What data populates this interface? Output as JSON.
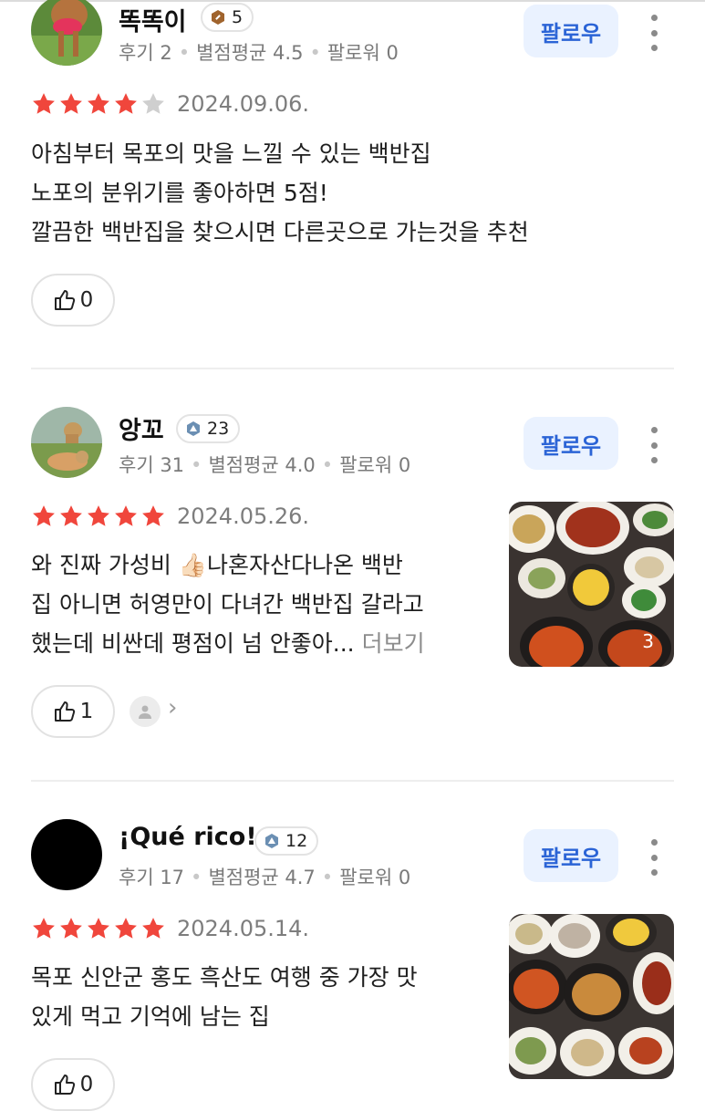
{
  "follow_label": "팔로우",
  "reviews": [
    {
      "username": "똑똑이",
      "badge_level": "5",
      "stats": {
        "reviews": "후기 2",
        "avg_rating": "별점평균 4.5",
        "followers": "팔로워 0"
      },
      "rating": 4,
      "date": "2024.09.06.",
      "lines": [
        "아침부터 목포의 맛을 느낄 수 있는 백반집",
        "노포의 분위기를 좋아하면 5점!",
        "깔끔한 백반집을 찾으시면 다른곳으로 가는것을 추천"
      ],
      "likes": "0"
    },
    {
      "username": "앙꼬",
      "badge_level": "23",
      "stats": {
        "reviews": "후기 31",
        "avg_rating": "별점평균 4.0",
        "followers": "팔로워 0"
      },
      "rating": 5,
      "date": "2024.05.26.",
      "lines": [
        "와 진짜 가성비 👍🏻나혼자산다나온 백반",
        "집 아니면 허영만이 다녀간 백반집 갈라고",
        "했는데 비싼데 평점이 넘 안좋아..."
      ],
      "more_label": "더보기",
      "photo_count": "3",
      "likes": "1"
    },
    {
      "username": "¡Qué rico!",
      "badge_level": "12",
      "stats": {
        "reviews": "후기 17",
        "avg_rating": "별점평균 4.7",
        "followers": "팔로워 0"
      },
      "rating": 5,
      "date": "2024.05.14.",
      "lines": [
        "목포 신안군 홍도 흑산도 여행 중 가장 맛",
        "있게 먹고 기억에 남는 집"
      ],
      "likes": "0"
    }
  ],
  "colors": {
    "star": "#f0463c",
    "star_empty": "#cfcfcf",
    "follow_bg": "#eaf2ff",
    "follow_text": "#2b64d6"
  }
}
